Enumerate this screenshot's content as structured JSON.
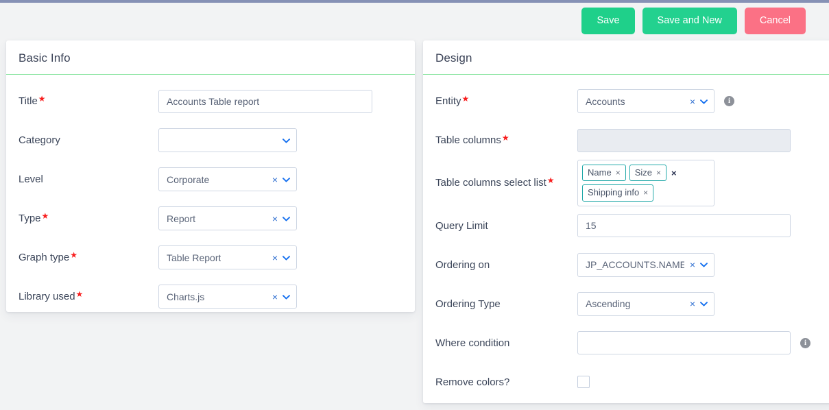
{
  "theme": {
    "topbar_color": "#8691b5",
    "page_bg": "#f2f3f4",
    "card_accent": "#86e49d",
    "tag_border": "#20a8a8",
    "required_color": "#f81d1d"
  },
  "toolbar": {
    "save_label": "Save",
    "save_and_new_label": "Save and New",
    "cancel_label": "Cancel",
    "save_color": "#1fd08a",
    "save_and_new_color": "#23d18f",
    "cancel_color": "#fb7185"
  },
  "basic_info": {
    "title": "Basic Info",
    "fields": {
      "title": {
        "label": "Title",
        "required": "★",
        "value": "Accounts Table report"
      },
      "category": {
        "label": "Category",
        "required": "",
        "value": ""
      },
      "level": {
        "label": "Level",
        "required": "",
        "value": "Corporate"
      },
      "type": {
        "label": "Type",
        "required": "★",
        "value": "Report"
      },
      "graph_type": {
        "label": "Graph type",
        "required": "★",
        "value": "Table Report"
      },
      "library_used": {
        "label": "Library used",
        "required": "★",
        "value": "Charts.js"
      }
    }
  },
  "design": {
    "title": "Design",
    "fields": {
      "entity": {
        "label": "Entity",
        "required": "★",
        "value": "Accounts"
      },
      "table_columns": {
        "label": "Table columns",
        "required": "★",
        "value": ""
      },
      "table_columns_select_list": {
        "label": "Table columns select list",
        "required": "★",
        "tags": [
          {
            "label": "Name",
            "remove": "×"
          },
          {
            "label": "Size",
            "remove": "×"
          },
          {
            "label": "Shipping info",
            "remove": "×"
          }
        ],
        "clear_all": "×"
      },
      "query_limit": {
        "label": "Query Limit",
        "required": "",
        "value": "15"
      },
      "ordering_on": {
        "label": "Ordering on",
        "required": "",
        "value": "JP_ACCOUNTS.NAME"
      },
      "ordering_type": {
        "label": "Ordering Type",
        "required": "",
        "value": "Ascending"
      },
      "where_condition": {
        "label": "Where condition",
        "required": "",
        "value": ""
      },
      "remove_colors": {
        "label": "Remove colors?",
        "required": "",
        "checked": ""
      }
    }
  },
  "icons": {
    "clear": "×",
    "chevron_down": "❯",
    "info": "i"
  }
}
